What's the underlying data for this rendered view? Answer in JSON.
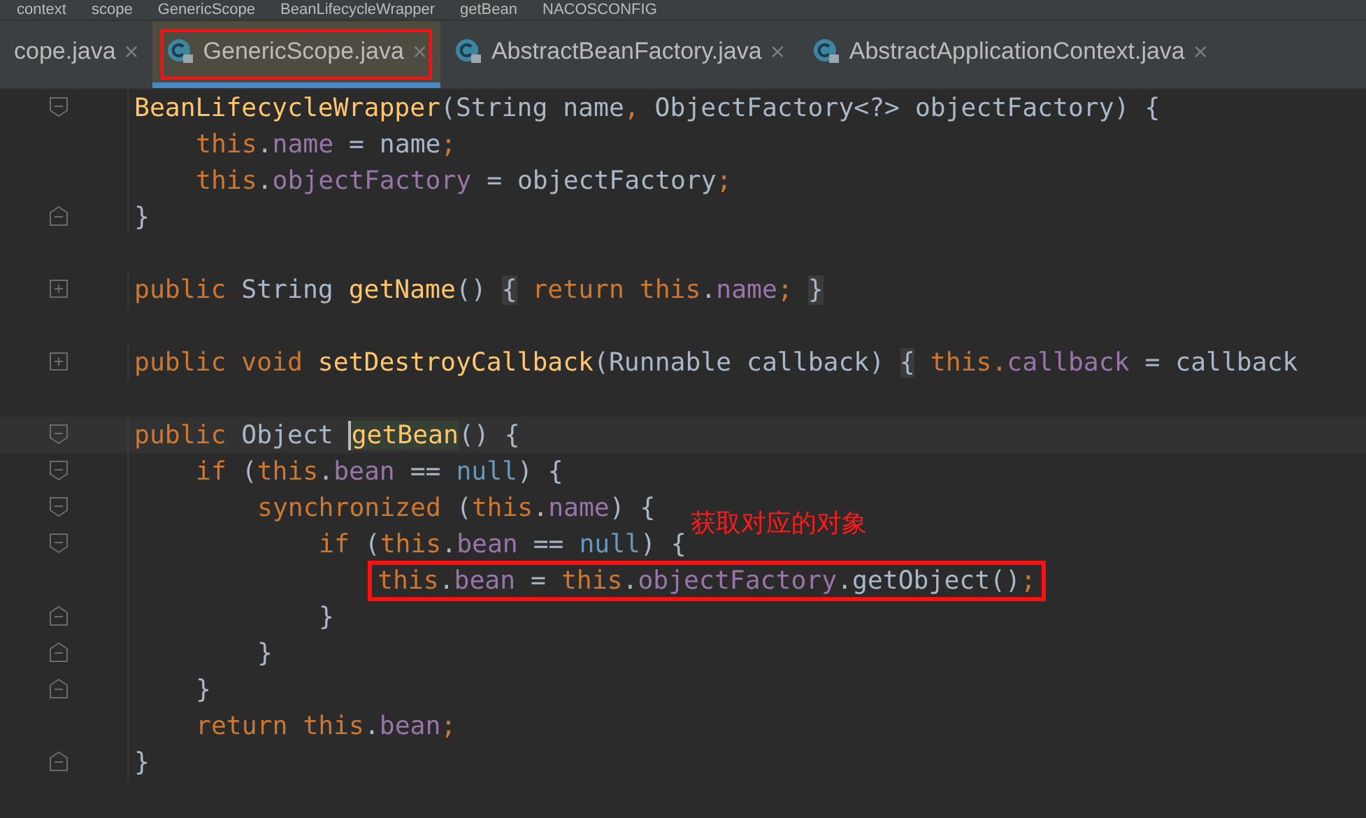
{
  "breadcrumbs": [
    "context",
    "scope",
    "GenericScope",
    "BeanLifecycleWrapper",
    "getBean",
    "NACOSCONFIG"
  ],
  "tabs": [
    {
      "label": "cope.java",
      "selected": false,
      "annotated": false
    },
    {
      "label": "GenericScope.java",
      "selected": true,
      "annotated": true
    },
    {
      "label": "AbstractBeanFactory.java",
      "selected": false,
      "annotated": false
    },
    {
      "label": "AbstractApplicationContext.java",
      "selected": false,
      "annotated": false
    }
  ],
  "close_glyph": "×",
  "lines": [
    {
      "kind": "code",
      "foldable": true,
      "folded": false,
      "tokens": [
        {
          "kind": "decl",
          "text": "BeanLifecycleWrapper"
        },
        {
          "kind": "plain",
          "text": "(String name"
        },
        {
          "kind": "kw",
          "text": ","
        },
        {
          "kind": "plain",
          "text": " ObjectFactory<?> objectFactory) {"
        }
      ],
      "children": [
        {
          "kind": "code",
          "tokens": [
            {
              "kind": "kw",
              "text": "this"
            },
            {
              "kind": "plain",
              "text": "."
            },
            {
              "kind": "field",
              "text": "name"
            },
            {
              "kind": "plain",
              "text": " = name"
            },
            {
              "kind": "kw",
              "text": ";"
            }
          ]
        },
        {
          "kind": "code",
          "tokens": [
            {
              "kind": "kw",
              "text": "this"
            },
            {
              "kind": "plain",
              "text": "."
            },
            {
              "kind": "field",
              "text": "objectFactory"
            },
            {
              "kind": "plain",
              "text": " = objectFactory"
            },
            {
              "kind": "kw",
              "text": ";"
            }
          ]
        }
      ]
    },
    {
      "kind": "code",
      "fold_end": true,
      "tokens": [
        {
          "kind": "plain",
          "text": "}"
        }
      ]
    },
    {
      "kind": "blank"
    },
    {
      "kind": "code",
      "foldable": true,
      "folded": true,
      "tokens": [
        {
          "kind": "kw",
          "text": "public "
        },
        {
          "kind": "plain",
          "text": "String "
        },
        {
          "kind": "decl",
          "text": "getName"
        },
        {
          "kind": "plain",
          "text": "() "
        },
        {
          "kind": "fold",
          "text": "{"
        },
        {
          "kind": "kw",
          "text": " return this"
        },
        {
          "kind": "plain",
          "text": "."
        },
        {
          "kind": "field",
          "text": "name"
        },
        {
          "kind": "kw",
          "text": "; "
        },
        {
          "kind": "fold",
          "text": "}"
        }
      ]
    },
    {
      "kind": "blank"
    },
    {
      "kind": "code",
      "foldable": true,
      "folded": true,
      "tokens": [
        {
          "kind": "kw",
          "text": "public void "
        },
        {
          "kind": "decl",
          "text": "setDestroyCallback"
        },
        {
          "kind": "plain",
          "text": "(Runnable callback) "
        },
        {
          "kind": "fold",
          "text": "{"
        },
        {
          "kind": "kw",
          "text": " this."
        },
        {
          "kind": "field",
          "text": "callback"
        },
        {
          "kind": "plain",
          "text": " = callback"
        }
      ]
    },
    {
      "kind": "blank"
    },
    {
      "kind": "code",
      "foldable": true,
      "folded": false,
      "current": true,
      "tokens": [
        {
          "kind": "kw",
          "text": "public "
        },
        {
          "kind": "plain",
          "text": "Object "
        },
        {
          "kind": "decl",
          "text": "getBean",
          "highlight": true
        },
        {
          "kind": "plain",
          "text": "() {"
        }
      ],
      "children": [
        {
          "kind": "code",
          "foldable": true,
          "folded": false,
          "tokens": [
            {
              "kind": "kw",
              "text": "if "
            },
            {
              "kind": "plain",
              "text": "("
            },
            {
              "kind": "kw",
              "text": "this"
            },
            {
              "kind": "plain",
              "text": "."
            },
            {
              "kind": "field",
              "text": "bean"
            },
            {
              "kind": "plain",
              "text": " == "
            },
            {
              "kind": "literal",
              "text": "null"
            },
            {
              "kind": "plain",
              "text": ") {"
            }
          ],
          "children": [
            {
              "kind": "code",
              "foldable": true,
              "folded": false,
              "tokens": [
                {
                  "kind": "kw",
                  "text": "synchronized "
                },
                {
                  "kind": "plain",
                  "text": "("
                },
                {
                  "kind": "kw",
                  "text": "this"
                },
                {
                  "kind": "plain",
                  "text": "."
                },
                {
                  "kind": "field",
                  "text": "name"
                },
                {
                  "kind": "plain",
                  "text": ") {"
                }
              ],
              "children": [
                {
                  "kind": "code",
                  "foldable": true,
                  "folded": false,
                  "note": "获取对应的对象",
                  "tokens": [
                    {
                      "kind": "kw",
                      "text": "if "
                    },
                    {
                      "kind": "plain",
                      "text": "("
                    },
                    {
                      "kind": "kw",
                      "text": "this"
                    },
                    {
                      "kind": "plain",
                      "text": "."
                    },
                    {
                      "kind": "field",
                      "text": "bean"
                    },
                    {
                      "kind": "plain",
                      "text": " == "
                    },
                    {
                      "kind": "literal",
                      "text": "null"
                    },
                    {
                      "kind": "plain",
                      "text": ") {"
                    }
                  ],
                  "children": [
                    {
                      "kind": "code",
                      "boxed": true,
                      "tokens": [
                        {
                          "kind": "kw",
                          "text": "this"
                        },
                        {
                          "kind": "plain",
                          "text": "."
                        },
                        {
                          "kind": "field",
                          "text": "bean"
                        },
                        {
                          "kind": "plain",
                          "text": " = "
                        },
                        {
                          "kind": "kw",
                          "text": "this"
                        },
                        {
                          "kind": "plain",
                          "text": "."
                        },
                        {
                          "kind": "field",
                          "text": "objectFactory"
                        },
                        {
                          "kind": "plain",
                          "text": ".getObject()"
                        },
                        {
                          "kind": "kw",
                          "text": ";"
                        }
                      ]
                    }
                  ]
                },
                {
                  "kind": "code",
                  "fold_end": true,
                  "tokens": [
                    {
                      "kind": "plain",
                      "text": "}"
                    }
                  ]
                }
              ]
            },
            {
              "kind": "code",
              "fold_end": true,
              "tokens": [
                {
                  "kind": "plain",
                  "text": "}"
                }
              ]
            }
          ]
        },
        {
          "kind": "code",
          "fold_end": true,
          "tokens": [
            {
              "kind": "plain",
              "text": "}"
            }
          ]
        },
        {
          "kind": "code",
          "tokens": [
            {
              "kind": "kw",
              "text": "return this"
            },
            {
              "kind": "plain",
              "text": "."
            },
            {
              "kind": "field",
              "text": "bean"
            },
            {
              "kind": "kw",
              "text": ";"
            }
          ]
        }
      ]
    },
    {
      "kind": "code",
      "fold_end": true,
      "tokens": [
        {
          "kind": "plain",
          "text": "}"
        }
      ]
    }
  ]
}
